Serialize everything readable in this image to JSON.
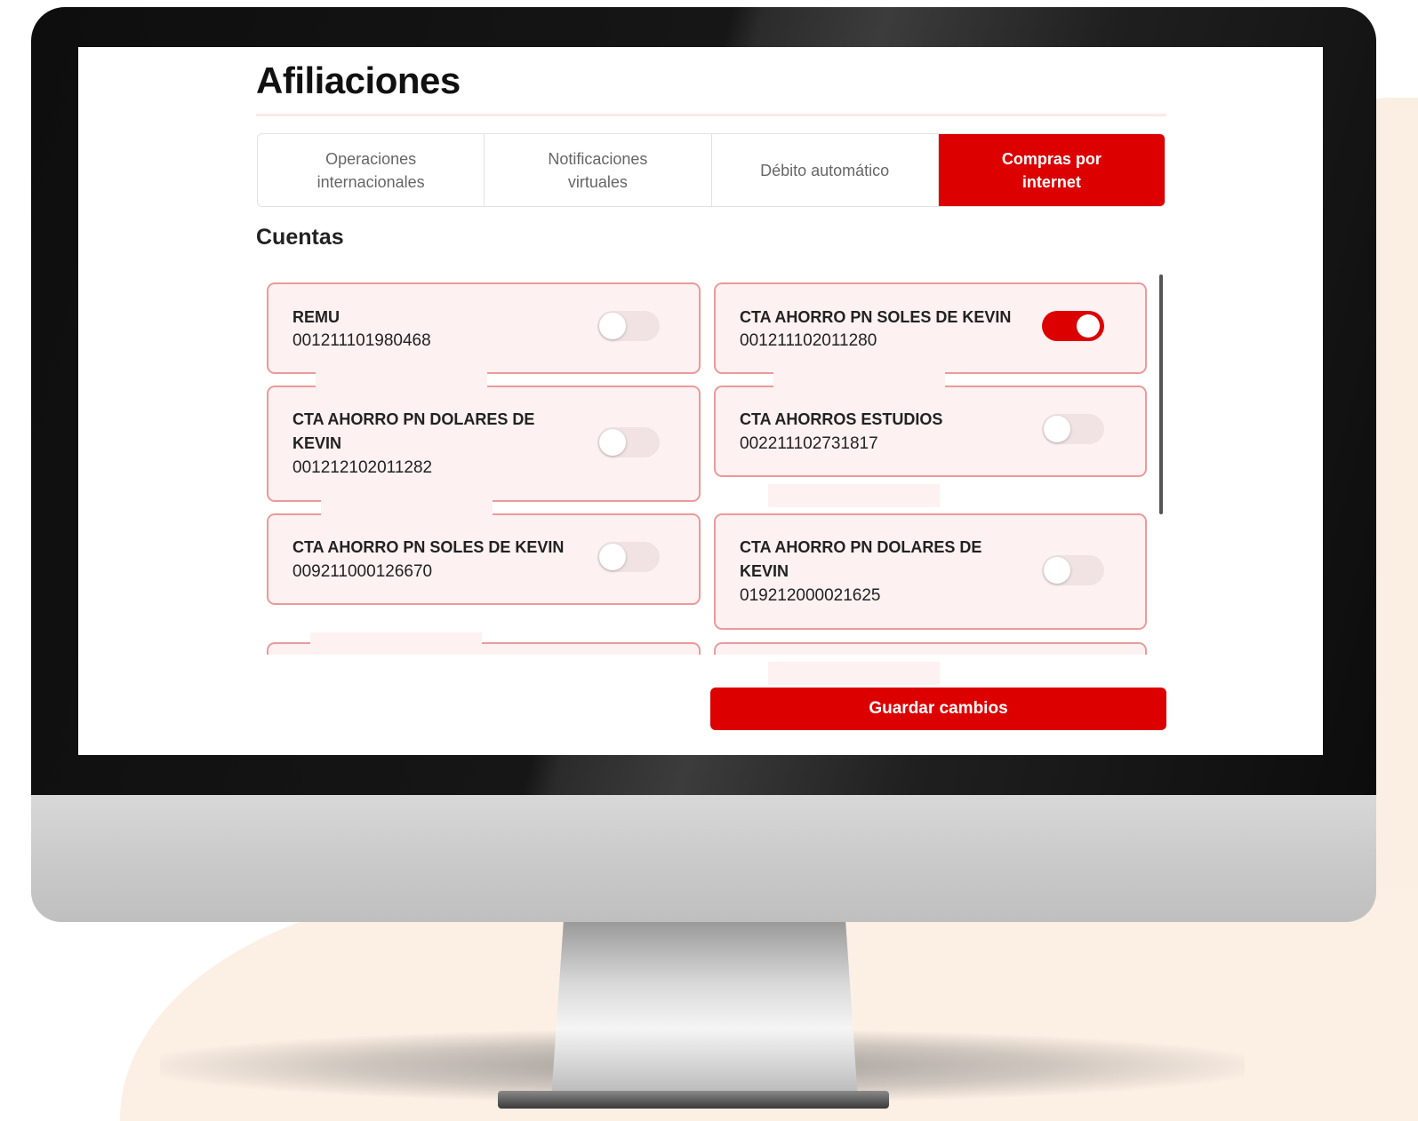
{
  "page": {
    "title": "Afiliaciones",
    "section_title": "Cuentas"
  },
  "tabs": [
    {
      "label": "Operaciones internacionales",
      "active": false
    },
    {
      "label": "Notificaciones virtuales",
      "active": false
    },
    {
      "label": "Débito automático",
      "active": false
    },
    {
      "label": "Compras por internet",
      "active": true
    }
  ],
  "accounts": [
    {
      "name": "REMU",
      "number": "001211101980468",
      "enabled": false
    },
    {
      "name": "CTA AHORRO PN SOLES DE KEVIN",
      "number": "001211102011280",
      "enabled": true
    },
    {
      "name": "CTA AHORRO PN DOLARES DE KEVIN",
      "number": "001212102011282",
      "enabled": false
    },
    {
      "name": "CTA AHORROS ESTUDIOS",
      "number": "002211102731817",
      "enabled": false
    },
    {
      "name": "CTA AHORRO PN SOLES DE KEVIN",
      "number": "009211000126670",
      "enabled": false
    },
    {
      "name": "CTA AHORRO PN DOLARES DE KEVIN",
      "number": "019212000021625",
      "enabled": false
    }
  ],
  "actions": {
    "save_label": "Guardar cambios"
  },
  "colors": {
    "accent": "#dc0000",
    "card_bg": "#fdf1f1",
    "card_border": "#ec9a9a"
  }
}
